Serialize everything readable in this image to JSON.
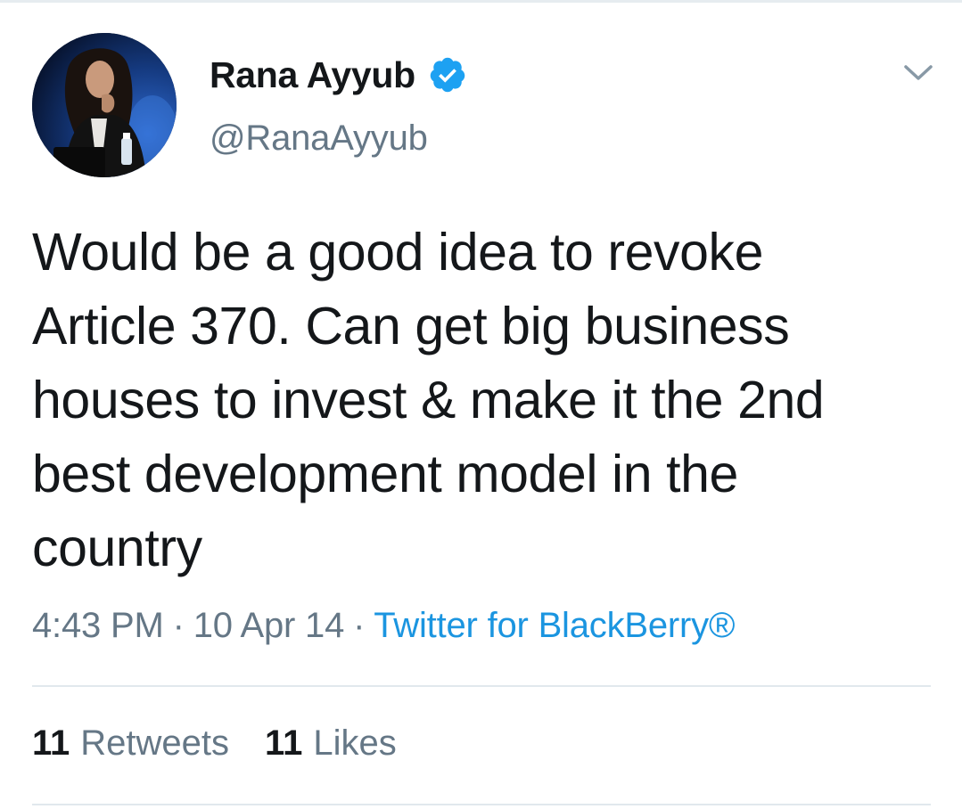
{
  "tweet": {
    "author": {
      "display_name": "Rana Ayyub",
      "handle": "@RanaAyyub",
      "verified": true
    },
    "text": "Would be a good idea to revoke\nArticle 370. Can get big business\nhouses to invest & make it the 2nd\nbest development model in the\ncountry",
    "time": "4:43 PM",
    "date": "10 Apr 14",
    "separator": "·",
    "source": "Twitter for BlackBerry®",
    "stats": {
      "retweets_count": "11",
      "retweets_label": "Retweets",
      "likes_count": "11",
      "likes_label": "Likes"
    }
  },
  "colors": {
    "text_primary": "#14171a",
    "text_secondary": "#657786",
    "link_blue": "#1b95e0",
    "divider": "#e1e8ed"
  },
  "icons": {
    "verified": "verified-badge-icon",
    "menu": "chevron-down-icon"
  }
}
